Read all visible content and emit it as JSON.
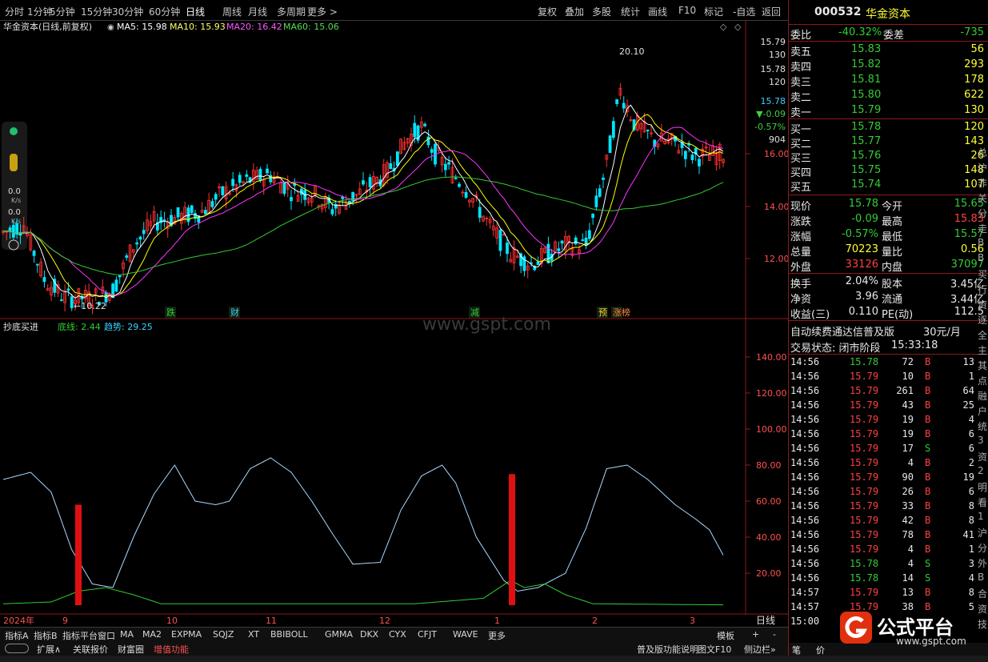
{
  "toolbar": {
    "periods": [
      "分时",
      "1分钟",
      "5分钟",
      "15分钟",
      "30分钟",
      "60分钟",
      "日线",
      "周线",
      "月线",
      "多周期",
      "更多 >"
    ],
    "tools": [
      "复权",
      "叠加",
      "多股",
      "统计",
      "画线",
      "F10",
      "标记",
      "-自选",
      "返回"
    ]
  },
  "main_chart": {
    "stock_title": "华金资本(日线,前复权)",
    "ma5_label": "MA5: 15.98",
    "ma10_label": "MA10: 15.93",
    "ma20_label": "MA20: 16.42",
    "ma60_label": "MA60: 15.06",
    "high_label": "20.10",
    "low_label": "←10.22",
    "price_ticks": [
      "16.00",
      "14.00",
      "12.00"
    ],
    "overlay_values": [
      "15.79",
      "130",
      "15.78",
      "120",
      "15.78",
      "▼-0.09",
      "-0.57%",
      "904"
    ],
    "event_labels": [
      "跌",
      "财",
      "减",
      "预",
      "涨榜"
    ],
    "left_indicators": [
      "0.0",
      "K/s",
      "0.0",
      "K/s"
    ],
    "watermark": "www.gspt.com"
  },
  "indicator": {
    "name": "抄底买进",
    "line1": "底线: 2.44",
    "line2": "趋势: 29.25",
    "ticks": [
      "140.00",
      "120.00",
      "100.00",
      "80.00",
      "60.00",
      "40.00",
      "20.00"
    ]
  },
  "x_axis": {
    "labels": [
      "2024年",
      "9",
      "10",
      "11",
      "12",
      "1",
      "2",
      "3"
    ],
    "period_label": "日线"
  },
  "bottom_tabs1": [
    "指标A",
    "指标B",
    "指标平台",
    "窗口",
    "MA",
    "MA2",
    "EXPMA",
    "SQJZ",
    "XT",
    "BBIBOLL",
    "GMMA",
    "DKX",
    "CYX",
    "CFJT",
    "WAVE",
    "更多"
  ],
  "bottom_tabs1_right": [
    "模板",
    "+",
    "-"
  ],
  "bottom_tabs2": [
    "扩展∧",
    "关联报价",
    "财富圈",
    "增值功能"
  ],
  "bottom_tabs2_right": [
    "普及版功能说明",
    "图文F10",
    "侧边栏»"
  ],
  "panel": {
    "code": "000532",
    "name": "华金资本",
    "webi_label": "委比",
    "webi_val": "-40.32%",
    "weicha_label": "委差",
    "weicha_val": "-735",
    "sells": [
      {
        "label": "卖五",
        "price": "15.83",
        "vol": "56"
      },
      {
        "label": "卖四",
        "price": "15.82",
        "vol": "293"
      },
      {
        "label": "卖三",
        "price": "15.81",
        "vol": "178"
      },
      {
        "label": "卖二",
        "price": "15.80",
        "vol": "622"
      },
      {
        "label": "卖一",
        "price": "15.79",
        "vol": "130"
      }
    ],
    "buys": [
      {
        "label": "买一",
        "price": "15.78",
        "vol": "120"
      },
      {
        "label": "买二",
        "price": "15.77",
        "vol": "143"
      },
      {
        "label": "买三",
        "price": "15.76",
        "vol": "26"
      },
      {
        "label": "买四",
        "price": "15.75",
        "vol": "148"
      },
      {
        "label": "买五",
        "price": "15.74",
        "vol": "107"
      }
    ],
    "stats": [
      {
        "l1": "现价",
        "v1": "15.78",
        "l2": "今开",
        "v2": "15.65"
      },
      {
        "l1": "涨跌",
        "v1": "-0.09",
        "l2": "最高",
        "v2": "15.83"
      },
      {
        "l1": "涨幅",
        "v1": "-0.57%",
        "l2": "最低",
        "v2": "15.57"
      },
      {
        "l1": "总量",
        "v1": "70223",
        "l2": "量比",
        "v2": "0.56"
      },
      {
        "l1": "外盘",
        "v1": "33126",
        "l2": "内盘",
        "v2": "37097"
      }
    ],
    "stats2": [
      {
        "l1": "换手",
        "v1": "2.04%",
        "l2": "股本",
        "v2": "3.45亿"
      },
      {
        "l1": "净资",
        "v1": "3.96",
        "l2": "流通",
        "v2": "3.44亿"
      },
      {
        "l1": "收益(三)",
        "v1": "0.110",
        "l2": "PE(动)",
        "v2": "112.5"
      }
    ],
    "promo": "自动续费通达信普及版",
    "promo_price": "30元/月",
    "trade_status": "交易状态: 闭市阶段",
    "trade_time": "15:33:18",
    "ticks": [
      {
        "t": "14:56",
        "p": "15.78",
        "v": "72",
        "bs": "B",
        "n": "13"
      },
      {
        "t": "14:56",
        "p": "15.79",
        "v": "10",
        "bs": "B",
        "n": "1"
      },
      {
        "t": "14:56",
        "p": "15.79",
        "v": "261",
        "bs": "B",
        "n": "64"
      },
      {
        "t": "14:56",
        "p": "15.79",
        "v": "43",
        "bs": "B",
        "n": "25"
      },
      {
        "t": "14:56",
        "p": "15.79",
        "v": "19",
        "bs": "B",
        "n": "4"
      },
      {
        "t": "14:56",
        "p": "15.79",
        "v": "19",
        "bs": "B",
        "n": "6"
      },
      {
        "t": "14:56",
        "p": "15.79",
        "v": "17",
        "bs": "S",
        "n": "6"
      },
      {
        "t": "14:56",
        "p": "15.79",
        "v": "4",
        "bs": "B",
        "n": "2"
      },
      {
        "t": "14:56",
        "p": "15.79",
        "v": "90",
        "bs": "B",
        "n": "19"
      },
      {
        "t": "14:56",
        "p": "15.79",
        "v": "26",
        "bs": "B",
        "n": "6"
      },
      {
        "t": "14:56",
        "p": "15.79",
        "v": "33",
        "bs": "B",
        "n": "8"
      },
      {
        "t": "14:56",
        "p": "15.79",
        "v": "42",
        "bs": "B",
        "n": "8"
      },
      {
        "t": "14:56",
        "p": "15.79",
        "v": "78",
        "bs": "B",
        "n": "41"
      },
      {
        "t": "14:56",
        "p": "15.79",
        "v": "4",
        "bs": "B",
        "n": "1"
      },
      {
        "t": "14:56",
        "p": "15.78",
        "v": "4",
        "bs": "S",
        "n": "3"
      },
      {
        "t": "14:56",
        "p": "15.78",
        "v": "14",
        "bs": "S",
        "n": "4"
      },
      {
        "t": "14:57",
        "p": "15.79",
        "v": "13",
        "bs": "B",
        "n": "8"
      },
      {
        "t": "14:57",
        "p": "15.79",
        "v": "38",
        "bs": "B",
        "n": "5"
      },
      {
        "t": "15:00",
        "p": "",
        "v": "",
        "bs": "",
        "n": ""
      }
    ],
    "side_chars": [
      "总",
      "沪",
      "非",
      "关",
      "分",
      "走",
      "B",
      "B",
      "买",
      "行",
      "资",
      "逐",
      "全",
      "主",
      "其",
      "点",
      "融",
      "户",
      "统",
      "3",
      "资",
      "2",
      "明",
      "看",
      "1",
      "沪",
      "分",
      "外",
      "B",
      "合",
      "资",
      "技"
    ],
    "bottom_right": [
      "笔",
      "价"
    ]
  },
  "logo": {
    "text": "公式平台",
    "url_text": "www.gspt.com"
  },
  "colors": {
    "up": "#ff3030",
    "down": "#00e5ff",
    "ma5": "#ffffff",
    "ma10": "#ffff00",
    "ma20": "#ff33ff",
    "ma60": "#33cc33",
    "grid_red": "#8b1a1a"
  }
}
